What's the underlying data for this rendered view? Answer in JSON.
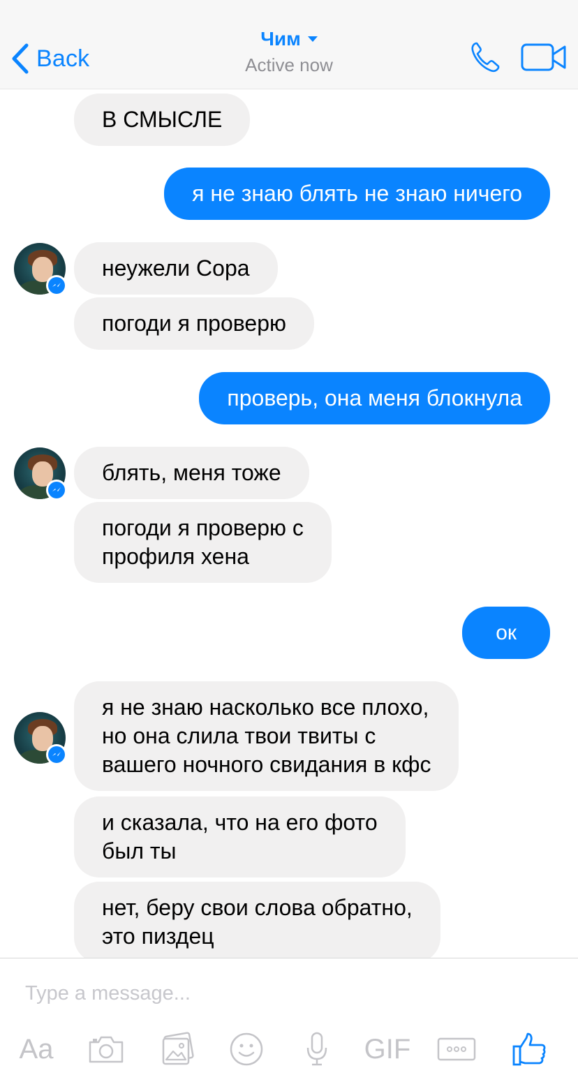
{
  "header": {
    "back_label": "Back",
    "contact_name": "Чим",
    "status": "Active now"
  },
  "messages": [
    {
      "side": "in",
      "text": "В СМЫСЛЕ"
    },
    {
      "side": "out",
      "text": "я не знаю блять не знаю ничего"
    },
    {
      "side": "in",
      "text": "неужели Сора"
    },
    {
      "side": "in",
      "text": "погоди я проверю"
    },
    {
      "side": "out",
      "text": "проверь, она меня блокнула"
    },
    {
      "side": "in",
      "text": "блять, меня тоже"
    },
    {
      "side": "in",
      "text": "погоди я проверю с\nпрофиля хена"
    },
    {
      "side": "out",
      "text": "ок"
    },
    {
      "side": "in",
      "text": "я не знаю насколько все плохо,\nно она слила твои твиты с\nвашего ночного свидания в кфс"
    },
    {
      "side": "in",
      "text": "и сказала, что на его фото\nбыл ты"
    },
    {
      "side": "in",
      "text": "нет, беру свои слова обратно,\nэто пиздец"
    }
  ],
  "composer": {
    "placeholder": "Type a message...",
    "text_tool_label": "Aa",
    "gif_label": "GIF",
    "icons": [
      "text-format-icon",
      "camera-icon",
      "photo-gallery-icon",
      "emoji-icon",
      "microphone-icon",
      "gif-icon",
      "more-icon",
      "thumbs-up-icon"
    ]
  },
  "colors": {
    "accent": "#0a84ff",
    "incoming_bubble": "#f1f0f0",
    "outgoing_bubble": "#0a84ff",
    "header_bg": "#f7f7f7"
  }
}
